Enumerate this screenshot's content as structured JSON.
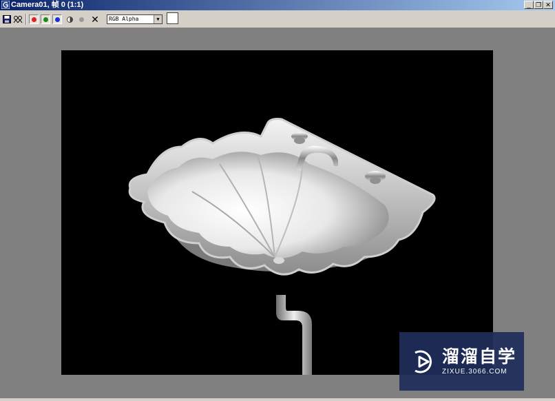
{
  "window": {
    "title": "Camera01, 帧 0 (1:1)",
    "controls": {
      "minimize": "_",
      "restore": "❐",
      "close": "✕"
    }
  },
  "toolbar": {
    "icons": [
      "save-icon",
      "clone-icon",
      "red-channel-icon",
      "green-channel-icon",
      "blue-channel-icon",
      "mono-icon",
      "alpha-icon",
      "clear-icon"
    ],
    "channel_select": "RGB Alpha",
    "swatch_color": "#ffffff",
    "clear_glyph": "✕"
  },
  "colors": {
    "red": "#e02020",
    "green": "#1a8a1a",
    "blue": "#1a2fd0",
    "frame_bg": "#808080",
    "viewport_bg": "#000000"
  },
  "viewport": {
    "image": "rendered-shell-shaped-sink"
  },
  "watermark": {
    "logo_text": "溜溜自学",
    "url": "ZIXUE.3066.COM"
  }
}
